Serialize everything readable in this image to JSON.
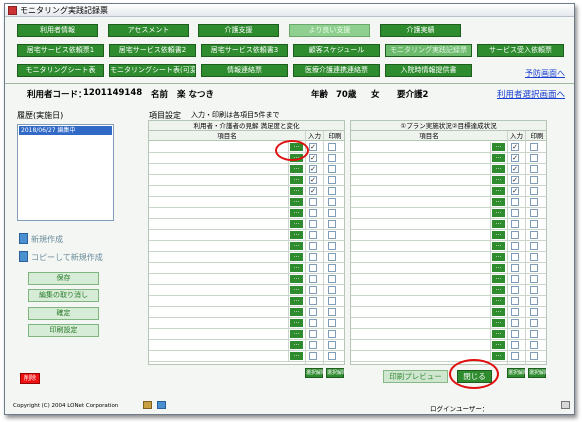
{
  "window": {
    "title": "モニタリング実践記録票"
  },
  "nav_row1": [
    "利用者情報",
    "アセスメント",
    "介護支援",
    "より良い支援",
    "介護実績"
  ],
  "nav_row2": [
    "居宅サービス依頼票1",
    "居宅サービス依頼書2",
    "居宅サービス依頼書3",
    "顧客スケジュール",
    "モニタリング実践記録票",
    "サービス受入依頼票"
  ],
  "nav_row3": [
    "モニタリングシート表",
    "モニタリングシート表(可変)",
    "情報連絡票",
    "医療介護連携連絡票",
    "入院時情報提供書"
  ],
  "links": {
    "prevention": "予防画面へ",
    "user_select": "利用者選択画面へ"
  },
  "user_info": {
    "code_label": "利用者コード：",
    "code": "1201149148",
    "name_label": "名前",
    "name": "楽 なつき",
    "age_label": "年齢",
    "age": "70歳",
    "gender": "女",
    "care_level": "要介護2"
  },
  "history": {
    "label": "履歴(実施日)",
    "items": [
      "2018/06/27 編集中"
    ]
  },
  "sidebar_actions": {
    "new": "新規作成",
    "copy_new": "コピーして新規作成"
  },
  "sidebar_buttons": [
    "保存",
    "編集の取り消し",
    "確定",
    "印刷設定"
  ],
  "red_button": "削除",
  "item_settings": {
    "label": "項目設定",
    "note": "入力・印刷は各項目5件まで"
  },
  "left_panel": {
    "title": "利用者・介護者の見解 満足度と変化",
    "col_item": "項目名",
    "col_input": "入力",
    "col_print": "印刷",
    "row_button": "…",
    "checked": [
      true,
      true,
      true,
      true,
      true,
      false,
      false,
      false,
      false,
      false,
      false,
      false,
      false,
      false,
      false,
      false,
      false,
      false,
      false,
      false
    ],
    "clear_button": "選択解除",
    "clear_button2": "選択解除"
  },
  "right_panel": {
    "title": "①プラン実施状況②目標達成状況",
    "col_item": "項目名",
    "col_input": "入力",
    "col_print": "印刷",
    "row_button": "…",
    "checked": [
      true,
      true,
      true,
      true,
      true,
      false,
      false,
      false,
      false,
      false,
      false,
      false,
      false,
      false,
      false,
      false,
      false,
      false,
      false,
      false
    ],
    "clear_button": "選択解除",
    "clear_button2": "選択解除"
  },
  "bottom_buttons": {
    "preview": "印刷プレビュー",
    "close": "閉じる"
  },
  "footer": {
    "copyright": "Copyright (C) 2004 LONet Corporation",
    "login_user": "ログインユーザー："
  },
  "colors": {
    "accent_green": "#2e8b2e",
    "highlight_red": "#e01010",
    "link_blue": "#1a3fd0"
  }
}
